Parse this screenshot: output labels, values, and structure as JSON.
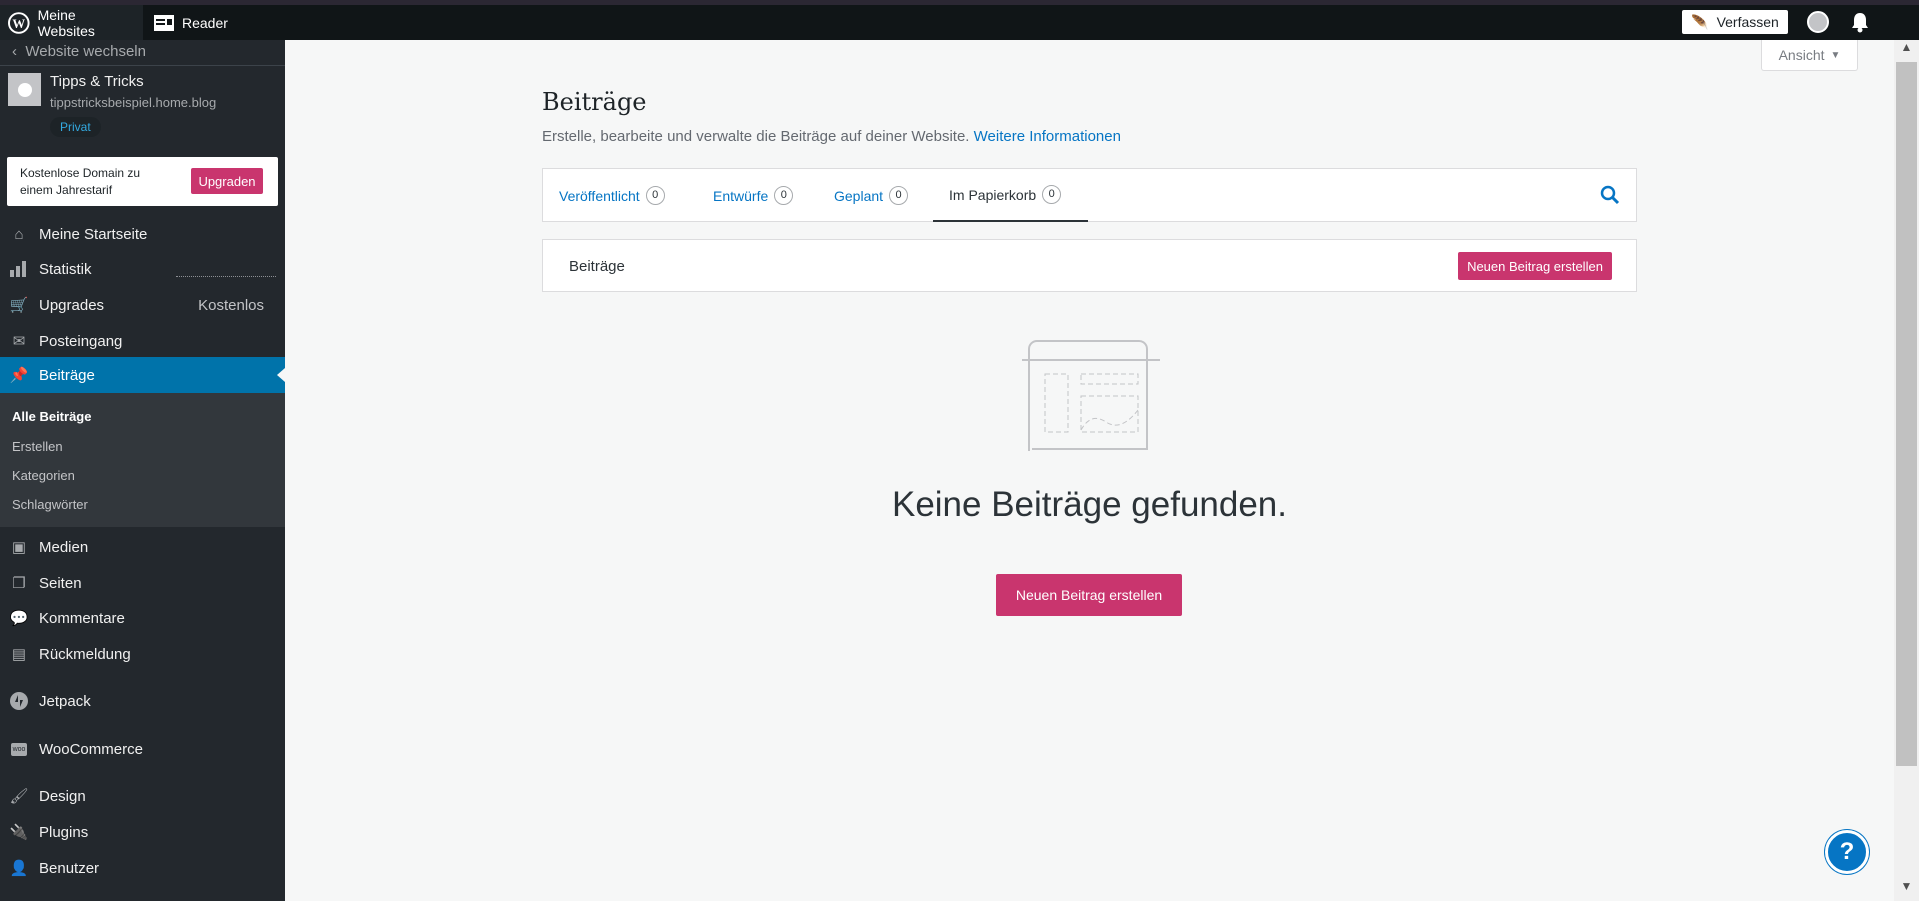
{
  "masterbar": {
    "my_sites": "Meine Websites",
    "reader": "Reader",
    "compose": "Verfassen"
  },
  "sidebar": {
    "switch_site": "Website wechseln",
    "site": {
      "title": "Tipps & Tricks",
      "url": "tippstricksbeispiel.home.blog",
      "badge": "Privat"
    },
    "upsell": {
      "text": "Kostenlose Domain zu einem Jahrestarif",
      "button": "Upgraden"
    },
    "items": [
      {
        "label": "Meine Startseite",
        "icon": "home-icon"
      },
      {
        "label": "Statistik",
        "icon": "stats-icon"
      },
      {
        "label": "Upgrades",
        "icon": "cart-icon",
        "badge": "Kostenlos"
      },
      {
        "label": "Posteingang",
        "icon": "mail-icon"
      },
      {
        "label": "Beiträge",
        "icon": "pin-icon",
        "active": true
      },
      {
        "label": "Medien",
        "icon": "media-icon"
      },
      {
        "label": "Seiten",
        "icon": "pages-icon"
      },
      {
        "label": "Kommentare",
        "icon": "comment-icon"
      },
      {
        "label": "Rückmeldung",
        "icon": "feedback-icon"
      },
      {
        "label": "Jetpack",
        "icon": "jetpack-icon"
      },
      {
        "label": "WooCommerce",
        "icon": "woo-icon"
      },
      {
        "label": "Design",
        "icon": "brush-icon"
      },
      {
        "label": "Plugins",
        "icon": "plug-icon"
      },
      {
        "label": "Benutzer",
        "icon": "user-icon"
      }
    ],
    "submenu": [
      "Alle Beiträge",
      "Erstellen",
      "Kategorien",
      "Schlagwörter"
    ]
  },
  "main": {
    "view_button": "Ansicht",
    "title": "Beiträge",
    "subtitle": "Erstelle, bearbeite und verwalte die Beiträge auf deiner Website.",
    "learn_more": "Weitere Informationen",
    "tabs": [
      {
        "label": "Veröffentlicht",
        "count": "0"
      },
      {
        "label": "Entwürfe",
        "count": "0"
      },
      {
        "label": "Geplant",
        "count": "0"
      },
      {
        "label": "Im Papierkorb",
        "count": "0",
        "selected": true
      }
    ],
    "list_header": "Beiträge",
    "new_post_small": "Neuen Beitrag erstellen",
    "empty_title": "Keine Beiträge gefunden.",
    "new_post_big": "Neuen Beitrag erstellen",
    "help": "?"
  },
  "colors": {
    "accent": "#0073aa",
    "pink": "#c9356e",
    "link": "#0675c4"
  }
}
